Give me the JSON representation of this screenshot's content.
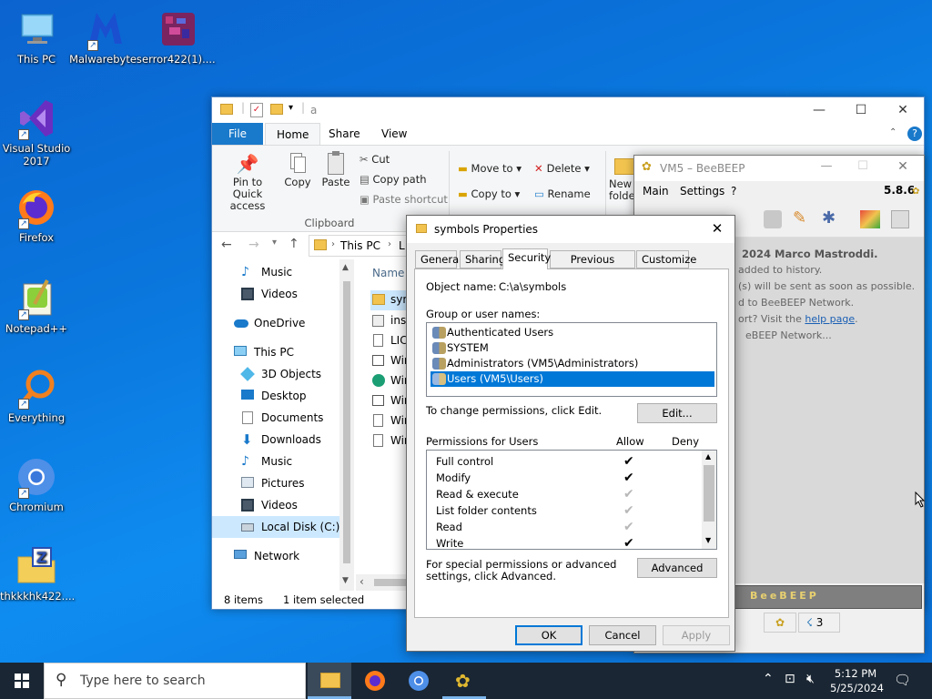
{
  "desktop": {
    "icons": [
      {
        "label": "This PC",
        "icon": "this-pc-icon"
      },
      {
        "label": "Malwarebytes",
        "icon": "malwarebytes-icon"
      },
      {
        "label": "error422(1)....",
        "icon": "archive-file-icon"
      },
      {
        "label": "Visual Studio 2017",
        "icon": "visual-studio-icon"
      },
      {
        "label": "Firefox",
        "icon": "firefox-icon"
      },
      {
        "label": "Notepad++",
        "icon": "notepadpp-icon"
      },
      {
        "label": "Everything",
        "icon": "everything-search-icon"
      },
      {
        "label": "Chromium",
        "icon": "chromium-icon"
      },
      {
        "label": "thkkkhk422....",
        "icon": "zip-folder-icon"
      }
    ]
  },
  "explorer": {
    "address_folder": "a",
    "tabs": {
      "file": "File",
      "home": "Home",
      "share": "Share",
      "view": "View"
    },
    "ribbon": {
      "pin": "Pin to Quick access",
      "copy": "Copy",
      "paste": "Paste",
      "cut": "Cut",
      "copy_path": "Copy path",
      "paste_shortcut": "Paste shortcut",
      "clipboard_group": "Clipboard",
      "move_to": "Move to",
      "copy_to": "Copy to",
      "delete": "Delete",
      "rename": "Rename",
      "new_folder": "New folde"
    },
    "breadcrumb": {
      "root": "This PC",
      "next": "L"
    },
    "nav": {
      "music_top": "Music",
      "videos_top": "Videos",
      "onedrive": "OneDrive",
      "this_pc": "This PC",
      "objects3d": "3D Objects",
      "desktop": "Desktop",
      "documents": "Documents",
      "downloads": "Downloads",
      "music": "Music",
      "pictures": "Pictures",
      "videos": "Videos",
      "local_disk": "Local Disk (C:)",
      "network": "Network"
    },
    "column_name": "Name",
    "files": [
      "sym",
      "inst",
      "LIC",
      "Wir",
      "Wir",
      "Wir",
      "Wir",
      "Wir"
    ],
    "status": {
      "count": "8 items",
      "selected": "1 item selected"
    }
  },
  "beebeep": {
    "title": "VM5 – BeeBEEP",
    "menu": {
      "main": "Main",
      "settings": "Settings",
      "help": "?"
    },
    "version": "5.8.6",
    "log": [
      "2024 Marco Mastroddi.",
      "added to history.",
      "(s) will be sent as soon as possible.",
      "d to BeeBEEP Network.",
      "ort? Visit the ",
      "eBEEP Network..."
    ],
    "help_link": "help page",
    "log_suffix": ".",
    "banner": "BeeBEEP",
    "status_count": "3"
  },
  "dialog": {
    "title": "symbols Properties",
    "tabs": {
      "general": "General",
      "sharing": "Sharing",
      "security": "Security",
      "previous": "Previous Versions",
      "customize": "Customize"
    },
    "object_label": "Object name:",
    "object_value": "C:\\a\\symbols",
    "group_label": "Group or user names:",
    "users": [
      "Authenticated Users",
      "SYSTEM",
      "Administrators (VM5\\Administrators)",
      "Users (VM5\\Users)"
    ],
    "change_text": "To change permissions, click Edit.",
    "edit_btn": "Edit...",
    "perm_label": "Permissions for Users",
    "allow": "Allow",
    "deny": "Deny",
    "permissions": [
      "Full control",
      "Modify",
      "Read & execute",
      "List folder contents",
      "Read",
      "Write"
    ],
    "special_text": "For special permissions or advanced settings, click Advanced.",
    "advanced_btn": "Advanced",
    "ok": "OK",
    "cancel": "Cancel",
    "apply": "Apply"
  },
  "taskbar": {
    "search_placeholder": "Type here to search",
    "time": "5:12 PM",
    "date": "5/25/2024"
  }
}
